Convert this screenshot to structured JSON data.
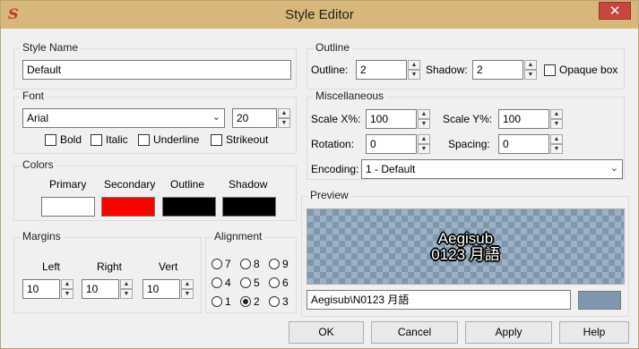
{
  "window": {
    "title": "Style Editor",
    "app_icon": "S",
    "close_glyph": "✕"
  },
  "style_name": {
    "group": "Style Name",
    "value": "Default"
  },
  "font": {
    "group": "Font",
    "family": "Arial",
    "size": "20",
    "bold": "Bold",
    "italic": "Italic",
    "underline": "Underline",
    "strikeout": "Strikeout"
  },
  "colors": {
    "group": "Colors",
    "primary_label": "Primary",
    "secondary_label": "Secondary",
    "outline_label": "Outline",
    "shadow_label": "Shadow",
    "primary": "#ffffff",
    "secondary": "#ff0000",
    "outline": "#000000",
    "shadow": "#000000"
  },
  "margins": {
    "group": "Margins",
    "left_label": "Left",
    "right_label": "Right",
    "vert_label": "Vert",
    "left": "10",
    "right": "10",
    "vert": "10"
  },
  "alignment": {
    "group": "Alignment",
    "options": [
      "7",
      "8",
      "9",
      "4",
      "5",
      "6",
      "1",
      "2",
      "3"
    ],
    "selected": "2"
  },
  "outline": {
    "group": "Outline",
    "outline_label": "Outline:",
    "outline_value": "2",
    "shadow_label": "Shadow:",
    "shadow_value": "2",
    "opaque_box": "Opaque box"
  },
  "misc": {
    "group": "Miscellaneous",
    "scale_x_label": "Scale X%:",
    "scale_x": "100",
    "scale_y_label": "Scale Y%:",
    "scale_y": "100",
    "rotation_label": "Rotation:",
    "rotation": "0",
    "spacing_label": "Spacing:",
    "spacing": "0",
    "encoding_label": "Encoding:",
    "encoding": "1 - Default"
  },
  "preview": {
    "group": "Preview",
    "line1": "Aegisub",
    "line2": "0123 月語",
    "text_field": "Aegisub\\N0123 月語",
    "bg_color": "#7f97ae"
  },
  "buttons": {
    "ok": "OK",
    "cancel": "Cancel",
    "apply": "Apply",
    "help": "Help"
  }
}
